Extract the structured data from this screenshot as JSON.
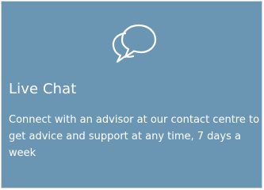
{
  "card": {
    "icon": "chat-bubbles-icon",
    "title": "Live Chat",
    "description": "Connect with an advisor at our contact centre to get advice and support at any time, 7 days a week",
    "background_color": "#6a96b3",
    "text_color": "#ffffff"
  }
}
